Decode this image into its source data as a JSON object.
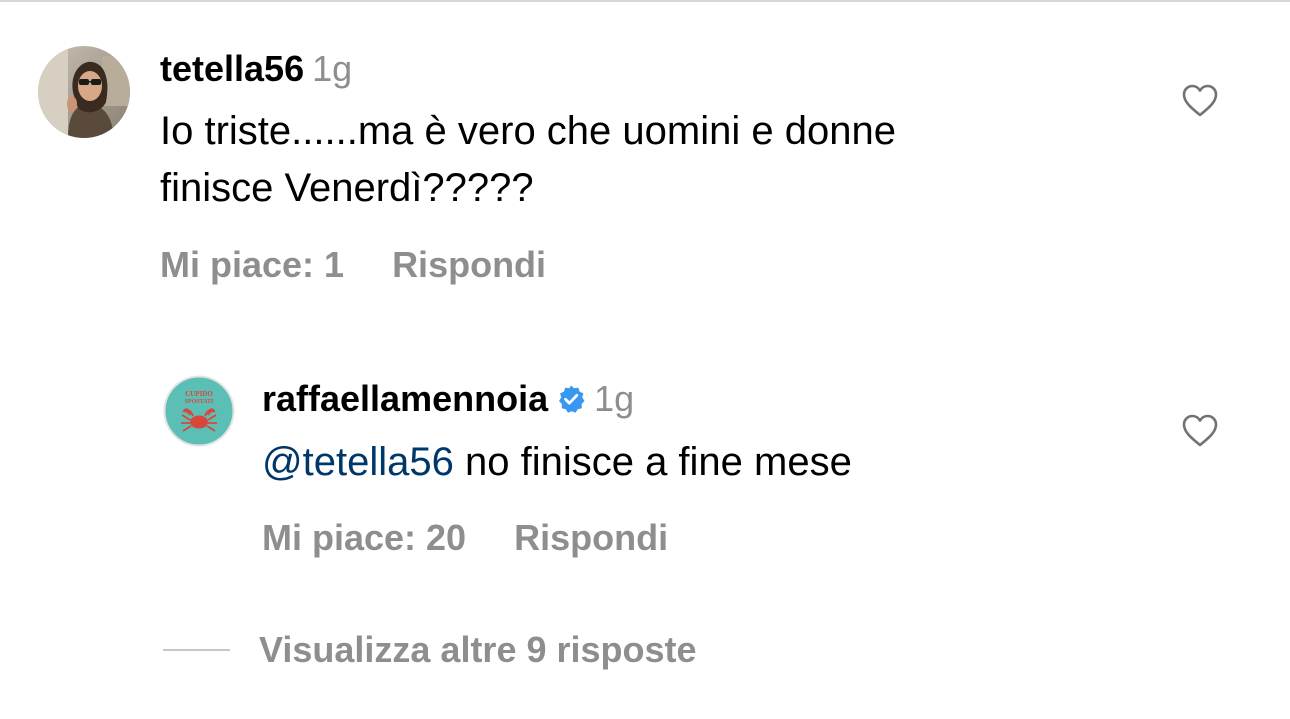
{
  "comments": [
    {
      "username": "tetella56",
      "time": "1g",
      "text_lines": [
        "Io triste......ma è vero che uomini e donne",
        "finisce Venerdì?????"
      ],
      "likes_label": "Mi piace: 1",
      "reply_label": "Rispondi",
      "avatar": "profile-photo-woman-sunglasses"
    },
    {
      "username": "raffaellamennoia",
      "verified": true,
      "time": "1g",
      "mention": "@tetella56",
      "text": "no finisce a fine mese",
      "likes_label": "Mi piace: 20",
      "reply_label": "Rispondi",
      "avatar": "cupido-spostati-book-cover",
      "avatar_text": "CUPIDO SPOSTATI"
    }
  ],
  "more_replies_label": "Visualizza altre 9 risposte",
  "colors": {
    "text": "#000000",
    "secondary": "#8e8e8e",
    "mention": "#00376b",
    "verified": "#3897f0",
    "avatar_teal": "#5bbfb5",
    "crab_red": "#d9473a"
  },
  "icons": {
    "like": "heart-outline-icon",
    "verified": "verified-badge-icon"
  }
}
